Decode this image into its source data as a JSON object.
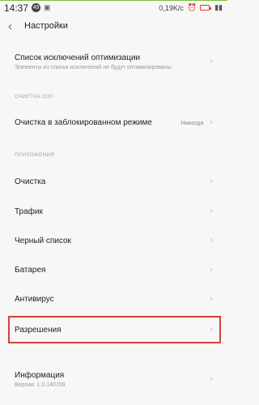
{
  "status_bar": {
    "time": "14:37",
    "badge": "49",
    "net_speed": "0,19K/c",
    "icons": [
      "photo-icon",
      "alarm-icon",
      "battery-icon",
      "signal-icon"
    ]
  },
  "header": {
    "title": "Настройки",
    "back_icon": "chevron-left-icon"
  },
  "optimization": {
    "title": "Список исключений оптимизации",
    "subtitle": "Элементы из списка исключений не будут оптимизированы"
  },
  "ram_section": {
    "header": "ОЧИСТКА ОЗУ",
    "locked_title": "Очистка в заблокированном режиме",
    "locked_value": "Никогда"
  },
  "apps_section": {
    "header": "ПРИЛОЖЕНИЯ",
    "items": [
      {
        "label": "Очистка"
      },
      {
        "label": "Трафик"
      },
      {
        "label": "Черный список"
      },
      {
        "label": "Батарея"
      },
      {
        "label": "Антивирус"
      },
      {
        "label": "Разрешения"
      }
    ]
  },
  "info": {
    "title": "Информация",
    "version": "Версия: 1.0.140709"
  },
  "colors": {
    "highlight": "#d5403a",
    "accent": "#7bbf3a"
  }
}
